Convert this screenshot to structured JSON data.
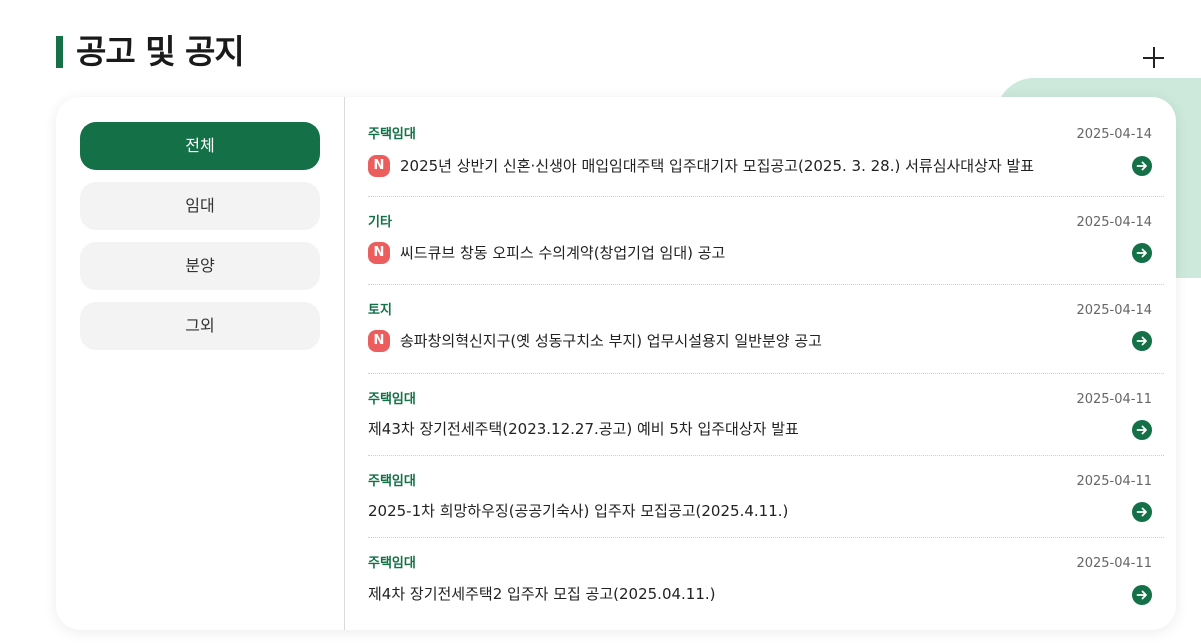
{
  "header": {
    "title": "공고 및 공지",
    "more_icon": "plus-icon"
  },
  "colors": {
    "brand": "#137047",
    "new_badge": "#ec5d5d",
    "accent_bg": "#cce9dc"
  },
  "tabs": [
    {
      "label": "전체",
      "active": true
    },
    {
      "label": "임대",
      "active": false
    },
    {
      "label": "분양",
      "active": false
    },
    {
      "label": "그외",
      "active": false
    }
  ],
  "notices": [
    {
      "category": "주택임대",
      "date": "2025-04-14",
      "new_label": "N",
      "title": "2025년 상반기 신혼·신생아 매입임대주택 입주대기자 모집공고(2025. 3. 28.) 서류심사대상자 발표"
    },
    {
      "category": "기타",
      "date": "2025-04-14",
      "new_label": "N",
      "title": "씨드큐브 창동 오피스 수의계약(창업기업 임대) 공고"
    },
    {
      "category": "토지",
      "date": "2025-04-14",
      "new_label": "N",
      "title": "송파창의혁신지구(옛 성동구치소 부지) 업무시설용지 일반분양 공고"
    },
    {
      "category": "주택임대",
      "date": "2025-04-11",
      "new_label": "",
      "title": "제43차 장기전세주택(2023.12.27.공고) 예비 5차 입주대상자 발표"
    },
    {
      "category": "주택임대",
      "date": "2025-04-11",
      "new_label": "",
      "title": "2025-1차 희망하우징(공공기숙사) 입주자 모집공고(2025.4.11.)"
    },
    {
      "category": "주택임대",
      "date": "2025-04-11",
      "new_label": "",
      "title": "제4차 장기전세주택2 입주자 모집 공고(2025.04.11.)"
    }
  ]
}
